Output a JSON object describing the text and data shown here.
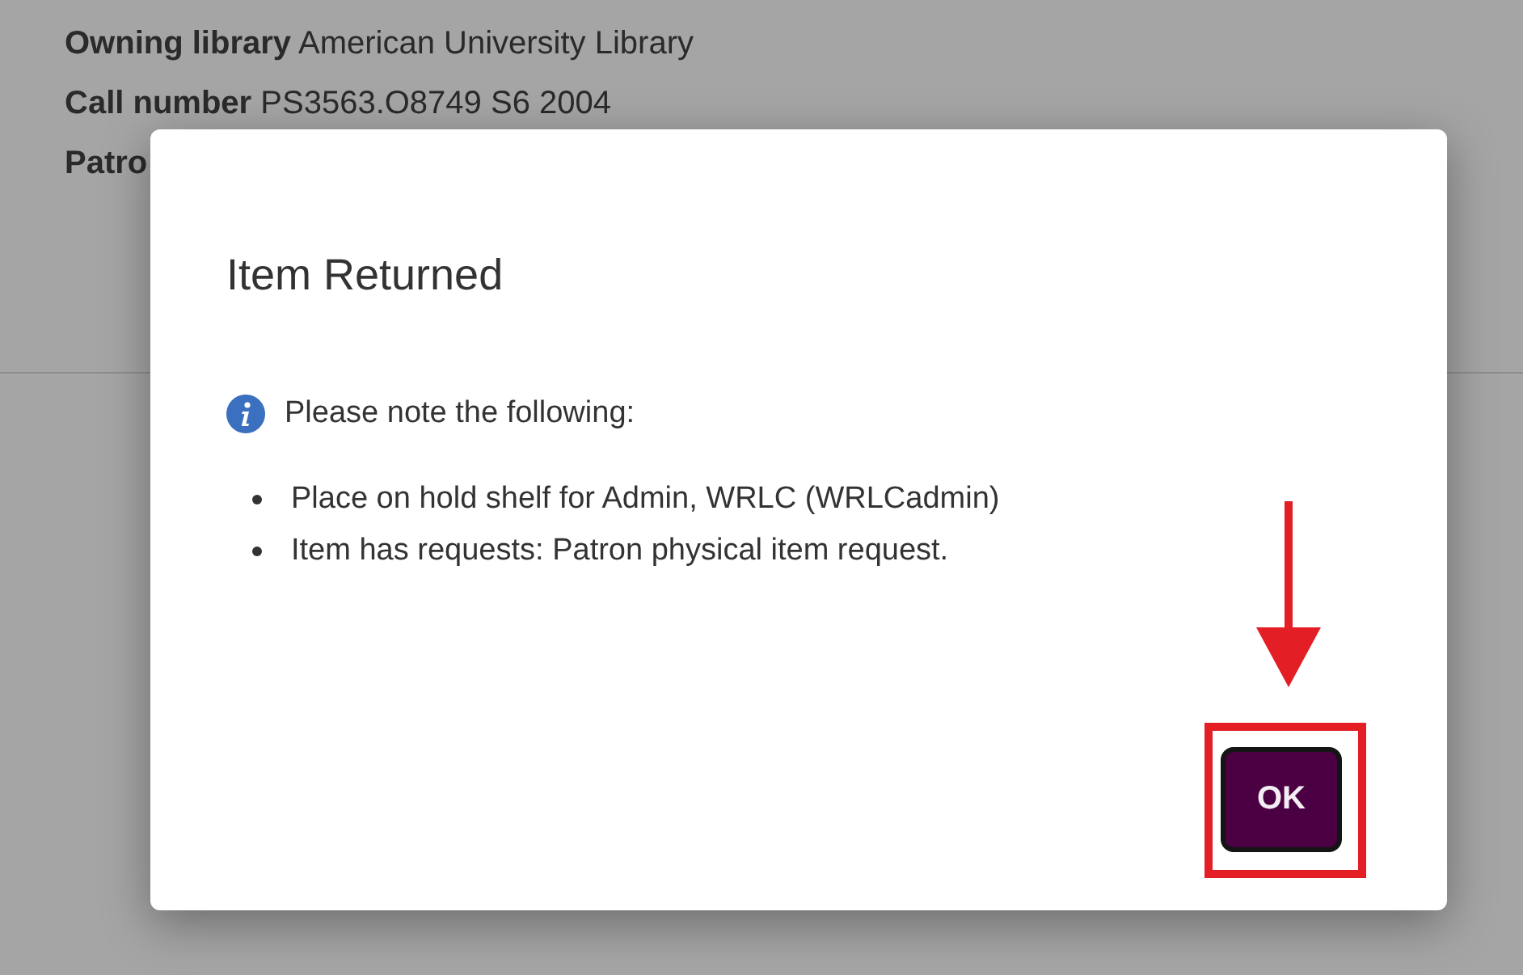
{
  "background": {
    "fields": [
      {
        "label": "Owning library",
        "value": "American University Library"
      },
      {
        "label": "Call number",
        "value": "PS3563.O8749 S6 2004"
      },
      {
        "label": "Patro"
      }
    ]
  },
  "dialog": {
    "title": "Item Returned",
    "note": "Please note the following:",
    "items": [
      "Place on hold shelf for Admin, WRLC (WRLCadmin)",
      "Item has requests: Patron physical item request."
    ],
    "buttons": [
      {
        "label": "OK",
        "highlighted": true
      }
    ]
  }
}
